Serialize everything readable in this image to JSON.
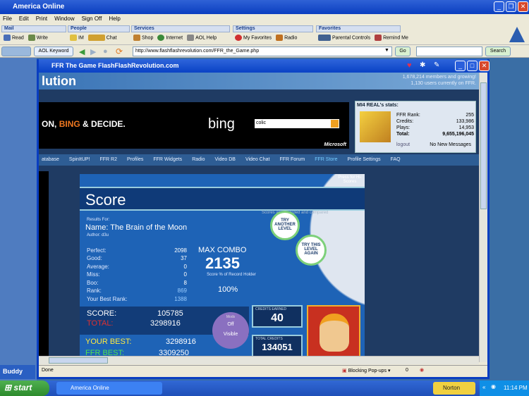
{
  "aol": {
    "title": "America  Online",
    "menu": [
      "File",
      "Edit",
      "Print",
      "Window",
      "Sign Off",
      "Help"
    ],
    "groups": [
      {
        "name": "Mail",
        "items": [
          "Read",
          "Write"
        ]
      },
      {
        "name": "People",
        "items": [
          "IM",
          "Chat"
        ]
      },
      {
        "name": "Services",
        "items": [
          "Shop",
          "Internet",
          "AOL Help"
        ]
      },
      {
        "name": "Settings",
        "items": [
          "My Favorites",
          "Radio"
        ]
      },
      {
        "name": "Favorites",
        "items": [
          "Parental Controls",
          "Remind Me"
        ]
      }
    ],
    "keyword_label": "AOL Keyword",
    "url": "http://www.flashflashrevolution.com/FFR_the_Game.php",
    "go_label": "Go",
    "search_label": "Search",
    "buddy_label": "Buddy"
  },
  "window": {
    "title": "FFR The Game FlashFlashRevolution.com",
    "status_left": "Done",
    "popup_label": "Blocking Pop-ups",
    "popup_count": "0"
  },
  "site": {
    "logo": "lution",
    "members": "1,678,214 members and growing!",
    "online": "1,130 users currently on FFR.",
    "ad_text1": "ON,",
    "ad_text2": "BING",
    "ad_text3": "& DECIDE.",
    "ad_brand": "bing",
    "ad_query": "colic",
    "ad_maker": "Microsoft",
    "stats_title": "MI4 REAL's stats:",
    "stats": [
      {
        "k": "FFR Rank:",
        "v": "255"
      },
      {
        "k": "Credits:",
        "v": "133,986"
      },
      {
        "k": "Plays:",
        "v": "14,953"
      },
      {
        "k": "Total:",
        "v": "9,655,196,045"
      }
    ],
    "logout": "logout",
    "messages": "No New Messages",
    "nav": [
      "atabase",
      "SpinItUP!",
      "FFR R2",
      "Profiles",
      "FFR Widgets",
      "Radio",
      "Video DB",
      "Video Chat",
      "FFR Forum",
      "FFR Store",
      "Profile Settings",
      "FAQ"
    ]
  },
  "game": {
    "title": "Score",
    "press": "Press for Hi-Scores",
    "recorded": "Scores are recorded and compared",
    "results_for": "Results For:",
    "song": "Name: The Brain of the Moon",
    "author": "Author: d3u",
    "judge": [
      {
        "k": "Perfect:",
        "v": "2098"
      },
      {
        "k": "Good:",
        "v": "37"
      },
      {
        "k": "Average:",
        "v": "0"
      },
      {
        "k": "Miss:",
        "v": "0"
      },
      {
        "k": "Boo:",
        "v": "8"
      },
      {
        "k": "Rank:",
        "v": "869"
      },
      {
        "k": "Your Best Rank:",
        "v": "1388"
      }
    ],
    "max_combo_label": "MAX COMBO",
    "max_combo": "2135",
    "record_label": "Score % of Record Holder",
    "record_pct": "100%",
    "try_another": "TRY ANOTHER LEVEL",
    "try_again": "TRY THIS LEVEL AGAIN",
    "score_label": "SCORE:",
    "score": "105785",
    "total_label": "TOTAL:",
    "total": "3298916",
    "your_best_label": "YOUR BEST:",
    "your_best": "3298916",
    "ffr_best_label": "FFR BEST:",
    "ffr_best": "3309250",
    "mods_label": "Mods",
    "mods_off": "Off",
    "mods_visible": "Visible",
    "credits_earned_label": "CREDITS EARNED",
    "credits_earned": "40",
    "total_credits_label": "TOTAL CREDITS",
    "total_credits": "134051"
  },
  "taskbar": {
    "start": "start",
    "task": "America  Online",
    "norton": "Norton",
    "time": "11:14 PM"
  }
}
